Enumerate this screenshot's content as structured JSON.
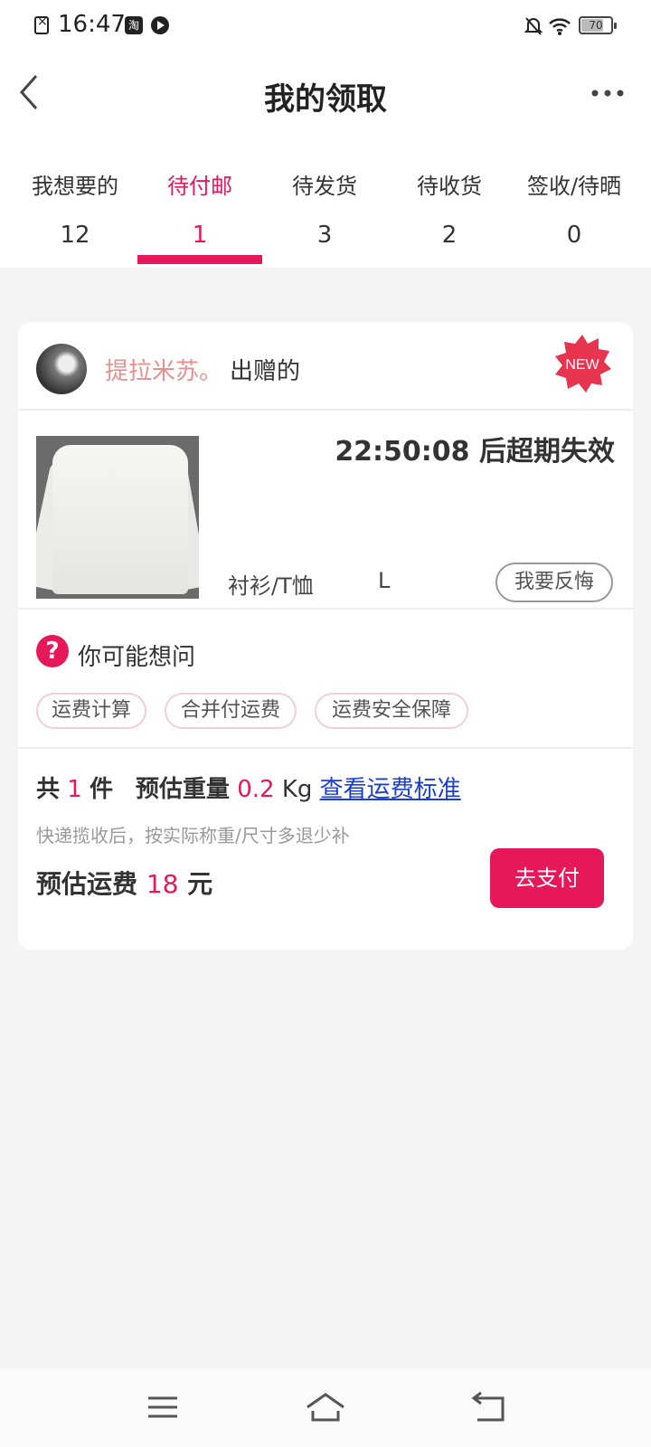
{
  "status_bar": {
    "time": "16:47",
    "battery": "70",
    "taobao_glyph": "淘"
  },
  "header": {
    "title": "我的领取"
  },
  "tabs": [
    {
      "label": "我想要的",
      "count": "12"
    },
    {
      "label": "待付邮",
      "count": "1"
    },
    {
      "label": "待发货",
      "count": "3"
    },
    {
      "label": "待收货",
      "count": "2"
    },
    {
      "label": "签收/待晒",
      "count": "0"
    }
  ],
  "active_tab_index": 1,
  "card": {
    "giver_name": "提拉米苏。",
    "giver_suffix": "出赠的",
    "badge": "NEW",
    "countdown": "22:50:08 后超期失效",
    "category": "衬衫/T恤",
    "size": "L",
    "regret_button": "我要反悔",
    "faq_icon": "?",
    "faq_title": "你可能想问",
    "faq_chips": [
      "运费计算",
      "合并付运费",
      "运费安全保障"
    ],
    "summary": {
      "total_prefix": "共",
      "count": "1",
      "unit": "件",
      "weight_label": "预估重量",
      "weight": "0.2",
      "weight_unit": "Kg",
      "link": "查看运费标准"
    },
    "note": "快递揽收后，按实际称重/尺寸多退少补",
    "fee": {
      "label": "预估运费",
      "amount": "18",
      "unit": "元"
    },
    "pay_button": "去支付"
  },
  "colors": {
    "accent": "#e6185a",
    "giver": "#e9908f",
    "link": "#1a3fd0"
  },
  "icons": [
    "back-arrow-icon",
    "more-icon",
    "new-badge-icon",
    "question-icon",
    "menu-icon",
    "home-icon",
    "return-icon"
  ]
}
